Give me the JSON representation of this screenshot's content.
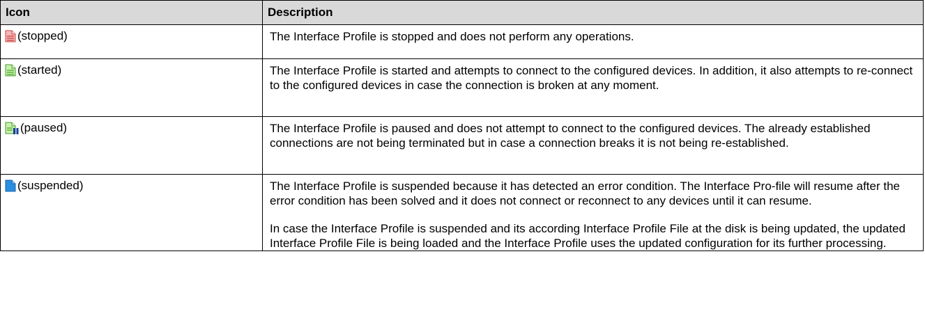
{
  "table": {
    "headers": {
      "icon": "Icon",
      "description": "Description"
    },
    "rows": [
      {
        "state": "(stopped)",
        "icon": "red-document-icon",
        "description": [
          "The Interface Profile is stopped and does not perform any operations."
        ]
      },
      {
        "state": "(started)",
        "icon": "green-document-icon",
        "description": [
          "The Interface Profile is started and attempts to connect to the configured devices. In addition, it also attempts to re-connect to the configured devices in case the connection is broken at any moment."
        ]
      },
      {
        "state": "(paused)",
        "icon": "green-document-paused-icon",
        "description": [
          "The Interface Profile is paused and does not attempt to connect to the configured devices. The already established connections are not being terminated but in case a connection breaks it is not being re-established."
        ]
      },
      {
        "state": "(suspended)",
        "icon": "blue-document-icon",
        "description": [
          "The Interface Profile is suspended because it has detected an error condition. The Interface Pro-file will resume after the error condition has been solved and it does not connect or reconnect to any devices until it can resume.",
          "In case the Interface Profile is suspended and its according Interface Profile File at the disk is being updated, the updated Interface Profile File is being loaded and the Interface Profile uses the updated configuration for its further processing."
        ]
      }
    ]
  },
  "colors": {
    "header_bg": "#d9d9d9",
    "stopped": "#e07070",
    "started": "#7ccf5a",
    "suspended": "#2a8fe0"
  }
}
